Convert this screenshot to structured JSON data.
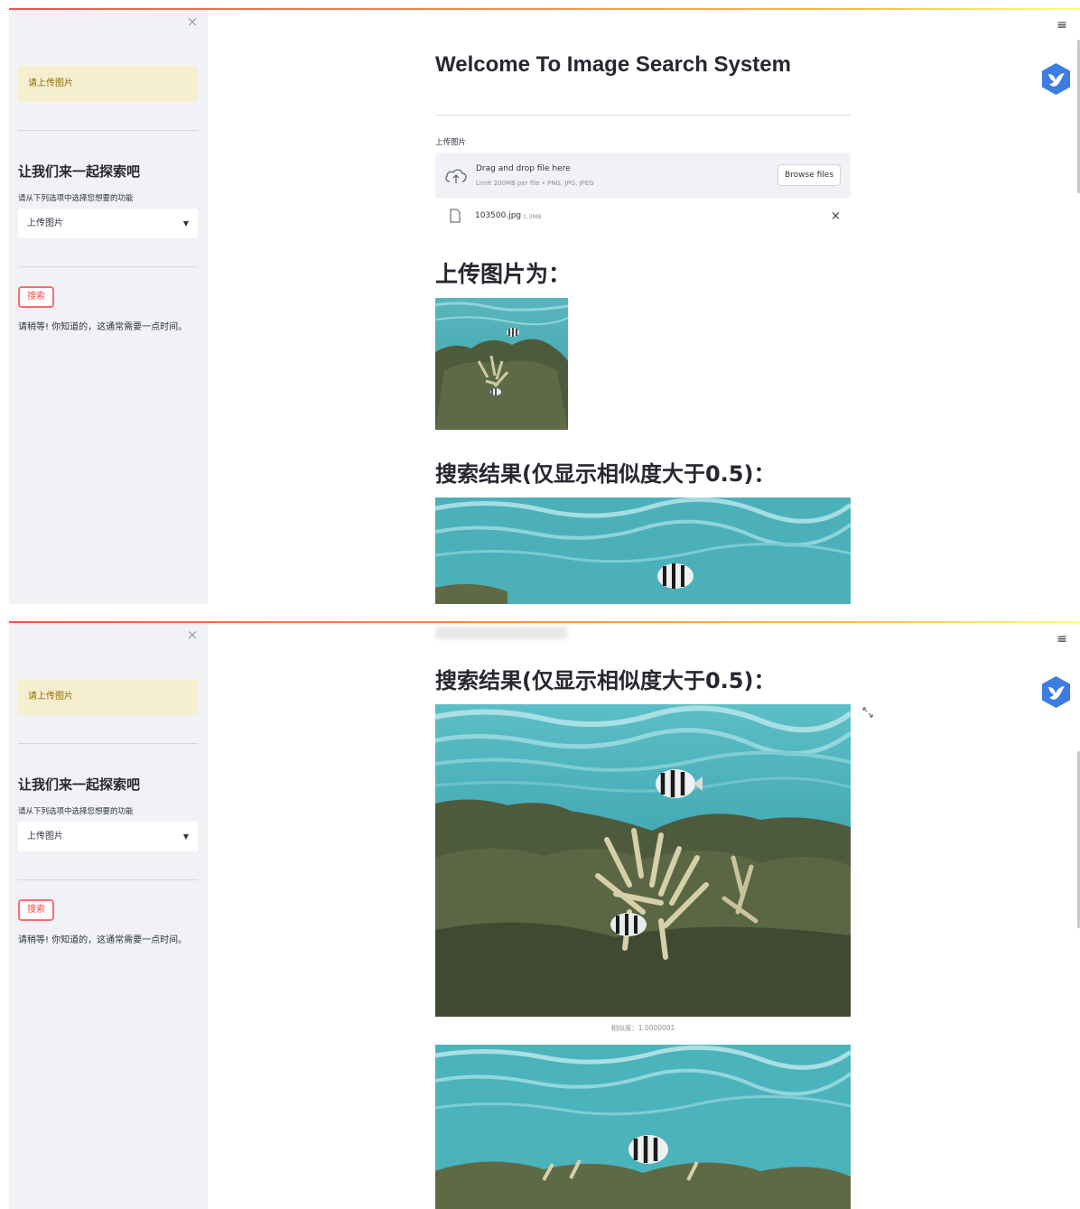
{
  "sidebar": {
    "close_glyph": "×",
    "alert": "请上传图片",
    "heading": "让我们来一起探索吧",
    "select_caption": "请从下列选项中选择您想要的功能",
    "select_value": "上传图片",
    "search_button": "搜索",
    "wait_text": "请稍等! 你知道的，这通常需要一点时间。"
  },
  "header": {
    "menu_glyph": "≡"
  },
  "main": {
    "title": "Welcome To Image Search System",
    "uploader_label": "上传图片",
    "dropzone_title": "Drag and drop file here",
    "dropzone_limit": "Limit 200MB per file • PNG, JPG, JPEG",
    "browse_label": "Browse files",
    "file_name": "103500.jpg",
    "file_size": "1.3MB",
    "file_remove_glyph": "×",
    "uploaded_heading": "上传图片为：",
    "results_heading": "搜索结果(仅显示相似度大于0.5)：",
    "result_caption_1": "相似度：1.0000001"
  },
  "colors": {
    "accent": "#ff4b4b",
    "sidebar_bg": "#f0f2f6",
    "alert_bg": "#f5efcf",
    "alert_text": "#926c05"
  }
}
